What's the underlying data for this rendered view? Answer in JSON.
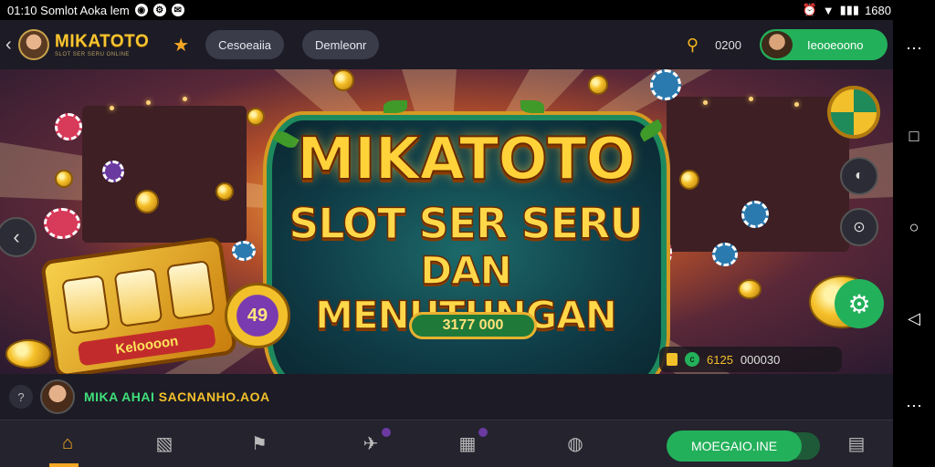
{
  "status_bar": {
    "left_text": "01:10 Somlot Aoka lem",
    "right_text": "1680"
  },
  "header": {
    "brand": "MIKATOTO",
    "brand_sub": "SLOT SER SERU ONLINE",
    "pill_1": "Cesoeaiia",
    "pill_2": "Demleonr",
    "balance": "0200",
    "user_button": "Ieooeoono"
  },
  "banner": {
    "title_line1": "MIKATOTO",
    "title_line2": "SLOT SER SERU",
    "title_line3": "DAN MENUTUNGAN",
    "prize": "3177 000",
    "slot_label": "Keloooon",
    "coin_label": "49",
    "ticker_value": "6125",
    "ticker_value2": "000030"
  },
  "announcement": {
    "name": "MIKA AHAI",
    "message": "SACNANHO.AOA"
  },
  "cta": {
    "label": "MOEGAIO.INE"
  },
  "icons": {
    "back": "chevron-left-icon",
    "star": "star-icon",
    "search": "search-icon",
    "settings": "gear-icon",
    "home": "home-icon",
    "more": "more-dots-icon",
    "square": "recent-apps-icon",
    "circle": "home-circle-icon",
    "triangle": "back-triangle-icon"
  },
  "colors": {
    "accent_green": "#23b05a",
    "brand_gold": "#f7c531",
    "header_bg": "#1c1b26"
  }
}
